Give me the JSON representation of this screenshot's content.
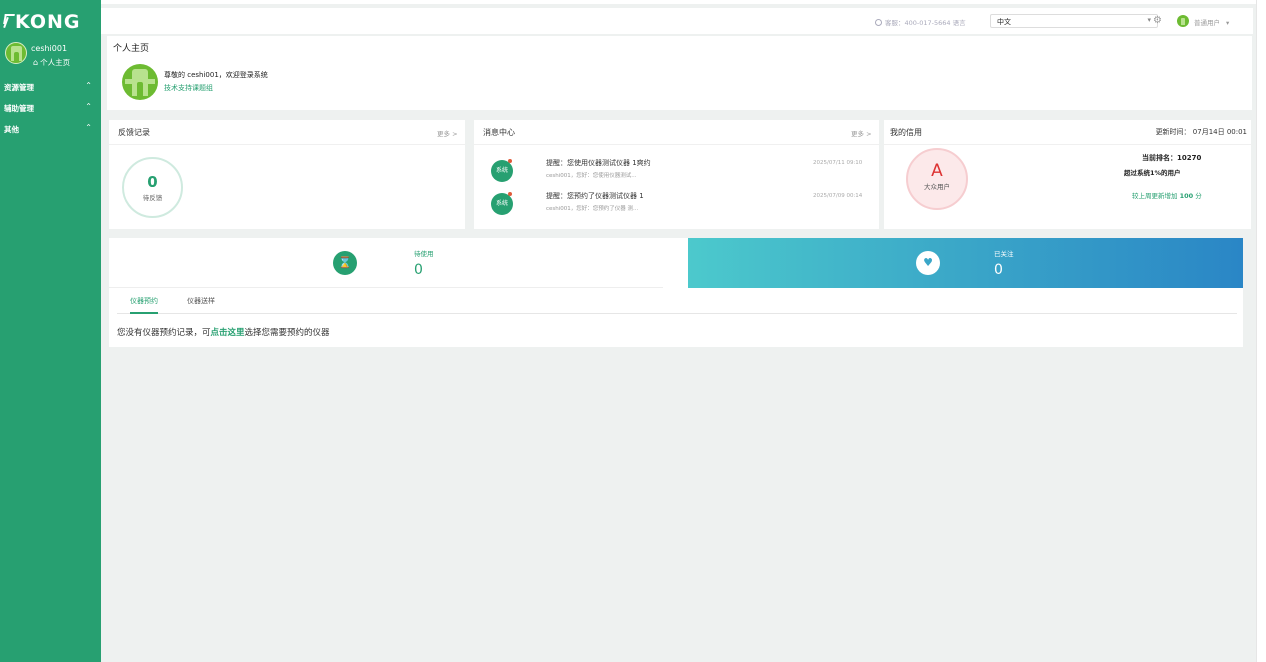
{
  "sidebar": {
    "logo": "KONG",
    "username": "ceshi001",
    "home_label": "个人主页",
    "menu": [
      {
        "label": "资源管理"
      },
      {
        "label": "辅助管理"
      },
      {
        "label": "其他"
      }
    ]
  },
  "header": {
    "service": "客服：400-017-5664 语言",
    "language": "中文",
    "user_role": "普通用户"
  },
  "profile": {
    "page_title": "个人主页",
    "welcome": "尊敬的 ceshi001，欢迎登录系统",
    "tech_support": "技术支持课题组"
  },
  "feedback": {
    "title": "反馈记录",
    "more": "更多 >",
    "count": "0",
    "label": "待反馈"
  },
  "messages": {
    "title": "消息中心",
    "more": "更多 >",
    "items": [
      {
        "badge": "系统",
        "title": "提醒：您使用仪器测试仪器 1爽约",
        "subtitle": "ceshi001，您好：您使用仪器测试...",
        "time": "2025/07/11 09:10"
      },
      {
        "badge": "系统",
        "title": "提醒：您预约了仪器测试仪器 1",
        "subtitle": "ceshi001，您好：您预约了仪器 测...",
        "time": "2025/07/09 00:14"
      }
    ]
  },
  "credit": {
    "title": "我的信用",
    "updated": "更新时间： 07月14日 00:01",
    "grade": "A",
    "level": "大众用户",
    "rank": "当前排名：10270",
    "surpass": "超过系统1%的用户",
    "increase_prefix": "较上周更新增加 ",
    "increase_value": "100",
    "increase_suffix": " 分"
  },
  "stats": {
    "pending_label": "待使用",
    "pending_value": "0",
    "followed_label": "已关注",
    "followed_value": "0"
  },
  "tabs": [
    {
      "label": "仪器预约",
      "active": true
    },
    {
      "label": "仪器送样",
      "active": false
    }
  ],
  "empty": {
    "prefix": "您没有仪器预约记录，可",
    "link": "点击这里",
    "suffix": "选择您需要预约的仪器"
  },
  "colors": {
    "primary": "#27a071",
    "accent_gradient_start": "#4cc9cc",
    "accent_gradient_end": "#2a86c6",
    "credit_grade": "#dd3333"
  }
}
